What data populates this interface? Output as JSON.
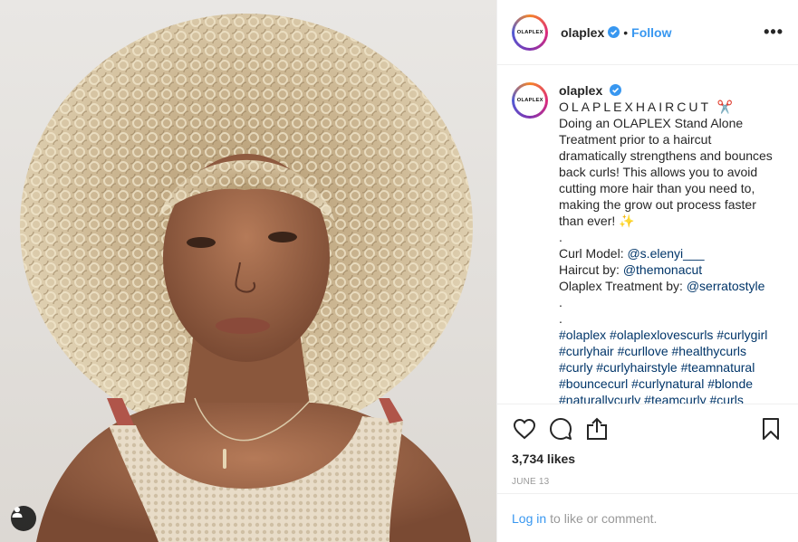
{
  "account": {
    "username": "olaplex",
    "avatar_text": "OLAPLEX",
    "verified_icon": "verified-badge-icon",
    "separator": "•",
    "follow_label": "Follow",
    "more_label": "•••"
  },
  "caption": {
    "username": "olaplex",
    "title": "OLAPLEXHAIRCUT ✂️",
    "body": "Doing an OLAPLEX Stand Alone Treatment prior to a haircut dramatically strengthens and bounces back curls! This allows you to avoid cutting more hair than you need to, making the grow out process faster than ever! ✨",
    "dot1": ".",
    "credits": [
      {
        "label": "Curl Model: ",
        "handle": "@s.elenyi___"
      },
      {
        "label": "Haircut by: ",
        "handle": "@themonacut"
      },
      {
        "label": "Olaplex Treatment by: ",
        "handle": "@serratostyle"
      }
    ],
    "dot2": ".",
    "dot3": ".",
    "hashtags": "#olaplex #olaplexlovescurls #curlygirl #curlyhair #curllove #healthycurls #curly #curlyhairstyle #teamnatural #bouncecurl #curlynatural #blonde #naturallycurly #teamcurly #curls"
  },
  "actions": {
    "like_icon": "heart-icon",
    "comment_icon": "comment-icon",
    "share_icon": "share-icon",
    "save_icon": "bookmark-icon",
    "likes": "3,734 likes",
    "date": "JUNE 13"
  },
  "login": {
    "link": "Log in",
    "text": "to like or comment."
  },
  "colors": {
    "link_blue": "#3897f0",
    "mention": "#003569",
    "border": "#efefef",
    "muted": "#999999"
  }
}
